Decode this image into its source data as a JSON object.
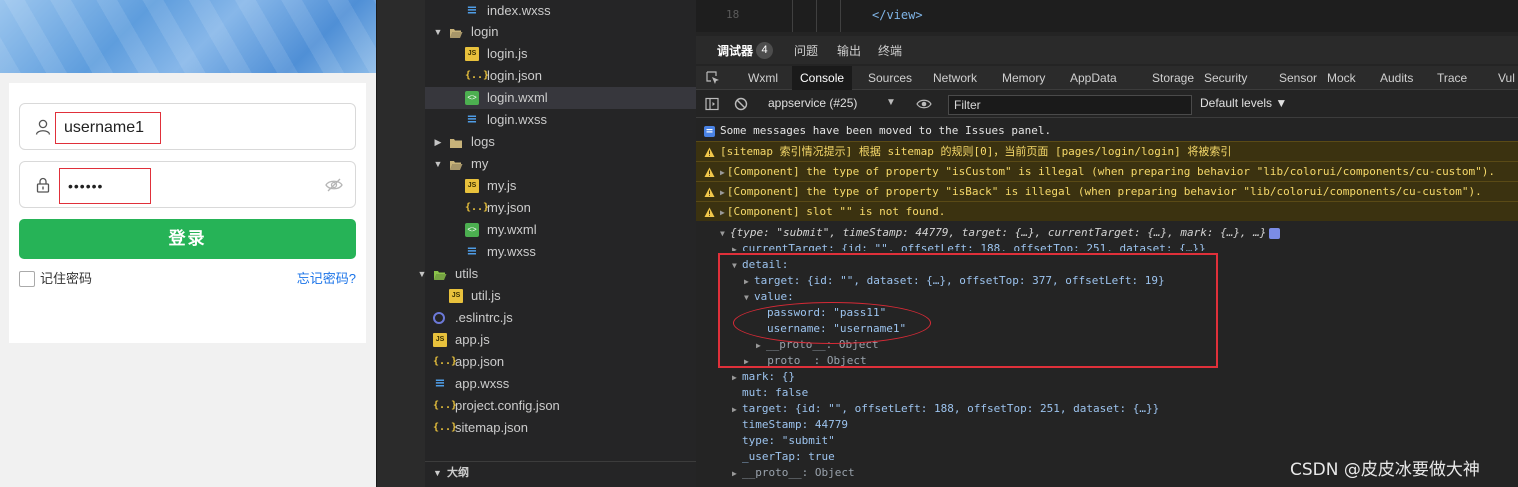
{
  "simulator": {
    "username_value": "username1",
    "password_value": "••••••",
    "login_button": "登录",
    "remember_label": "记住密码",
    "forgot_link": "忘记密码?"
  },
  "tree": {
    "items": [
      {
        "label": "index.wxss",
        "icon": "wxss-icon"
      },
      {
        "label": "login",
        "icon": "folder-open-icon"
      },
      {
        "label": "login.js",
        "icon": "js-file-icon"
      },
      {
        "label": "login.json",
        "icon": "json-file-icon"
      },
      {
        "label": "login.wxml",
        "icon": "wxml-file-icon"
      },
      {
        "label": "login.wxss",
        "icon": "wxss-icon"
      },
      {
        "label": "logs",
        "icon": "folder-icon"
      },
      {
        "label": "my",
        "icon": "folder-open-icon"
      },
      {
        "label": "my.js",
        "icon": "js-file-icon"
      },
      {
        "label": "my.json",
        "icon": "json-file-icon"
      },
      {
        "label": "my.wxml",
        "icon": "wxml-file-icon"
      },
      {
        "label": "my.wxss",
        "icon": "wxss-icon"
      },
      {
        "label": "utils",
        "icon": "folder-open-icon"
      },
      {
        "label": "util.js",
        "icon": "js-file-icon"
      },
      {
        "label": ".eslintrc.js",
        "icon": "eslint-icon"
      },
      {
        "label": "app.js",
        "icon": "js-file-icon"
      },
      {
        "label": "app.json",
        "icon": "json-file-icon"
      },
      {
        "label": "app.wxss",
        "icon": "wxss-icon"
      },
      {
        "label": "project.config.json",
        "icon": "json-file-icon"
      },
      {
        "label": "sitemap.json",
        "icon": "json-file-icon"
      }
    ],
    "outline_label": "大纲"
  },
  "editor": {
    "line_number": "18",
    "code": "</view>"
  },
  "debug_tabs": {
    "debugger": "调试器",
    "badge": "4",
    "issues": "问题",
    "output": "输出",
    "terminal": "终端"
  },
  "devtools_tabs": [
    "Wxml",
    "Console",
    "Sources",
    "Network",
    "Memory",
    "AppData",
    "Storage",
    "Security",
    "Sensor",
    "Mock",
    "Audits",
    "Trace",
    "Vul"
  ],
  "toolbar": {
    "context": "appservice (#25)",
    "filter_placeholder": "Filter",
    "levels": "Default levels ▼"
  },
  "console": {
    "info": "Some messages have been moved to the Issues panel.",
    "warn1": "[sitemap 索引情况提示] 根据 sitemap 的规则[0]，当前页面 [pages/login/login] 将被索引",
    "warn2": "[Component] the type of property \"isCustom\" is illegal (when preparing behavior \"lib/colorui/components/cu-custom\").",
    "warn3": "[Component] the type of property \"isBack\" is illegal (when preparing behavior \"lib/colorui/components/cu-custom\").",
    "warn4": "[Component] slot \"\" is not found.",
    "summary": "{type: \"submit\", timeStamp: 44779, target: {…}, currentTarget: {…}, mark: {…}, …}",
    "current_target": "currentTarget: {id: \"\", offsetLeft: 188, offsetTop: 251, dataset: {…}}",
    "detail": "detail:",
    "detail_target": "target: {id: \"\", dataset: {…}, offsetTop: 377, offsetLeft: 19}",
    "value": "value:",
    "password_line": "password: \"pass11\"",
    "username_line": "username: \"username1\"",
    "proto1": "__proto__: Object",
    "proto2": "__proto__: Object",
    "mark": "mark: {}",
    "mut": "mut: false",
    "target": "target: {id: \"\", offsetLeft: 188, offsetTop: 251, dataset: {…}}",
    "timestamp": "timeStamp: 44779",
    "type": "type: \"submit\"",
    "usertap": "_userTap: true",
    "proto3": "__proto__: Object"
  },
  "watermark": "CSDN @皮皮冰要做大神"
}
